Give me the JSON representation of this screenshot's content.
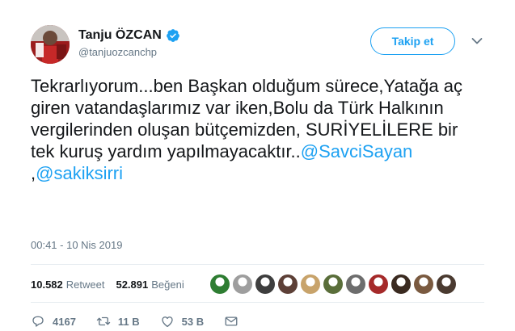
{
  "author": {
    "display_name": "Tanju ÖZCAN",
    "handle": "@tanjuozcanchp",
    "verified": true
  },
  "follow_button": {
    "label": "Takip et"
  },
  "tweet": {
    "text_before": "Tekrarlıyorum...ben Başkan olduğum sürece,Yatağa aç giren vatandaşlarımız var iken,Bolu da Türk Halkının vergilerinden oluşan bütçemizden, SURİYELİLERE bir tek kuruş yardım yapılmayacaktır..",
    "mention_1": "@SavciSayan",
    "separator": " ,",
    "mention_2": "@sakiksirri",
    "timestamp": "00:41 - 10 Nis 2019"
  },
  "stats": {
    "retweets_count": "10.582",
    "retweets_label": "Retweet",
    "likes_count": "52.891",
    "likes_label": "Beğeni"
  },
  "liker_avatar_colors": [
    "#2e7d32",
    "#9e9e9e",
    "#3e3e3e",
    "#5d4037",
    "#c8a36b",
    "#5a6e3a",
    "#6d6d6d",
    "#a52a2a",
    "#3a2a20",
    "#7a5a40",
    "#4a3a30"
  ],
  "actions": {
    "reply_count": "4167",
    "retweet_count": "11 B",
    "like_count": "53 B"
  },
  "colors": {
    "accent": "#1da1f2",
    "secondary_text": "#657786",
    "divider": "#e6ecf0"
  }
}
